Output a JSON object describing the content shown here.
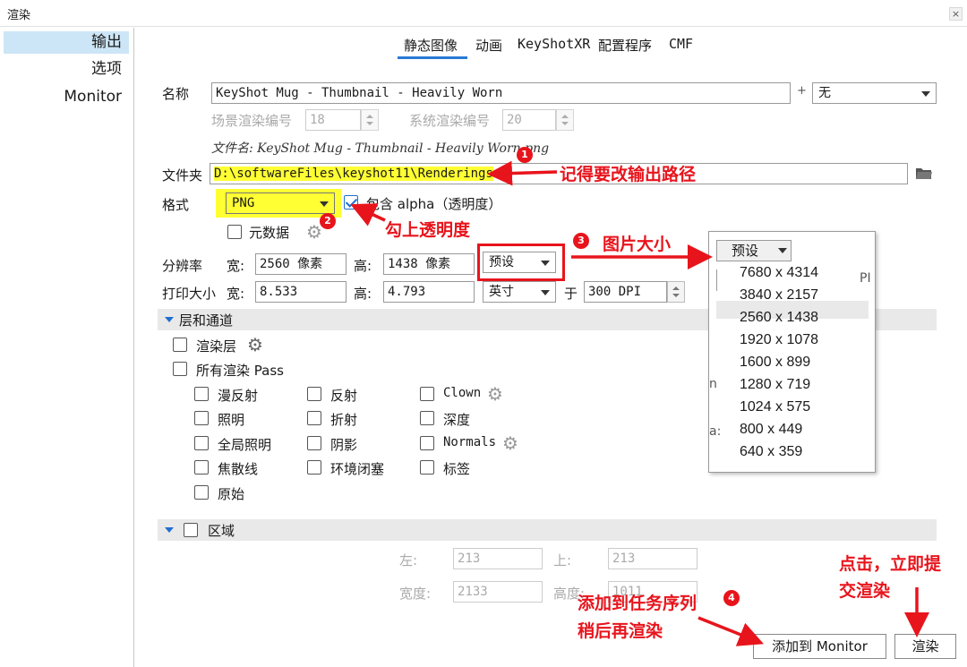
{
  "window": {
    "title": "渲染",
    "close": "×"
  },
  "sidebar": {
    "items": [
      {
        "label": "输出"
      },
      {
        "label": "选项"
      },
      {
        "label": "Monitor"
      }
    ]
  },
  "tabs": [
    {
      "label": "静态图像"
    },
    {
      "label": "动画"
    },
    {
      "label": "KeyShotXR"
    },
    {
      "label": "配置程序"
    },
    {
      "label": "CMF"
    }
  ],
  "form": {
    "name_label": "名称",
    "name_value": "KeyShot Mug - Thumbnail - Heavily Worn",
    "plus": "+",
    "name_select": "无",
    "scene_num_label": "场景渲染编号",
    "scene_num_value": "18",
    "system_num_label": "系统渲染编号",
    "system_num_value": "20",
    "filename": "文件名: KeyShot Mug - Thumbnail - Heavily Worn.png",
    "folder_label": "文件夹",
    "folder_value": "D:\\softwareFiles\\keyshot11\\Renderings",
    "format_label": "格式",
    "format_value": "PNG",
    "alpha_label": "包含 alpha（透明度）",
    "metadata_label": "元数据",
    "resolution_label": "分辨率",
    "width_label": "宽:",
    "width_value": "2560 像素",
    "height_label": "高:",
    "height_value": "1438 像素",
    "preset_label": "预设",
    "print_label": "打印大小",
    "print_width_label": "宽:",
    "print_width_value": "8.533",
    "print_height_label": "高:",
    "print_height_value": "4.793",
    "unit_value": "英寸",
    "at_label": "于",
    "dpi_value": "300 DPI"
  },
  "layers": {
    "section_title": "层和通道",
    "render_layers": "渲染层",
    "all_passes": "所有渲染 Pass",
    "passes": [
      "漫反射",
      "反射",
      "Clown",
      "照明",
      "折射",
      "深度",
      "全局照明",
      "阴影",
      "Normals",
      "焦散线",
      "环境闭塞",
      "标签",
      "原始"
    ]
  },
  "region": {
    "section_title": "区域",
    "left_label": "左:",
    "left_value": "213",
    "top_label": "上:",
    "top_value": "213",
    "width_label": "宽度:",
    "width_value": "2133",
    "height_label": "高度:",
    "height_value": "1011"
  },
  "buttons": {
    "add_monitor": "添加到 Monitor",
    "render": "渲染"
  },
  "popup": {
    "select_label": "预设",
    "options": [
      "7680 x 4314",
      "3840 x 2157",
      "2560 x 1438",
      "1920 x 1078",
      "1600 x 899",
      "1280 x 719",
      "1024 x 575",
      "800 x 449",
      "640 x 359"
    ],
    "behind_text_1": "PI",
    "behind_text_2": "n",
    "behind_text_3": "a:"
  },
  "annotations": {
    "badge1": "1",
    "note1": "记得要改输出路径",
    "badge2": "2",
    "note2": "勾上透明度",
    "badge3": "3",
    "note3": "图片大小",
    "badge4": "4",
    "note4_line1": "添加到任务序列",
    "note4_line2": "稍后再渲染",
    "note5_line1": "点击，立即提",
    "note5_line2": "交渲染"
  },
  "colors": {
    "accent": "#2a7ad5",
    "annotation": "#e8141c",
    "highlight": "#ffff33",
    "sidebar_active": "#cde6f7"
  }
}
